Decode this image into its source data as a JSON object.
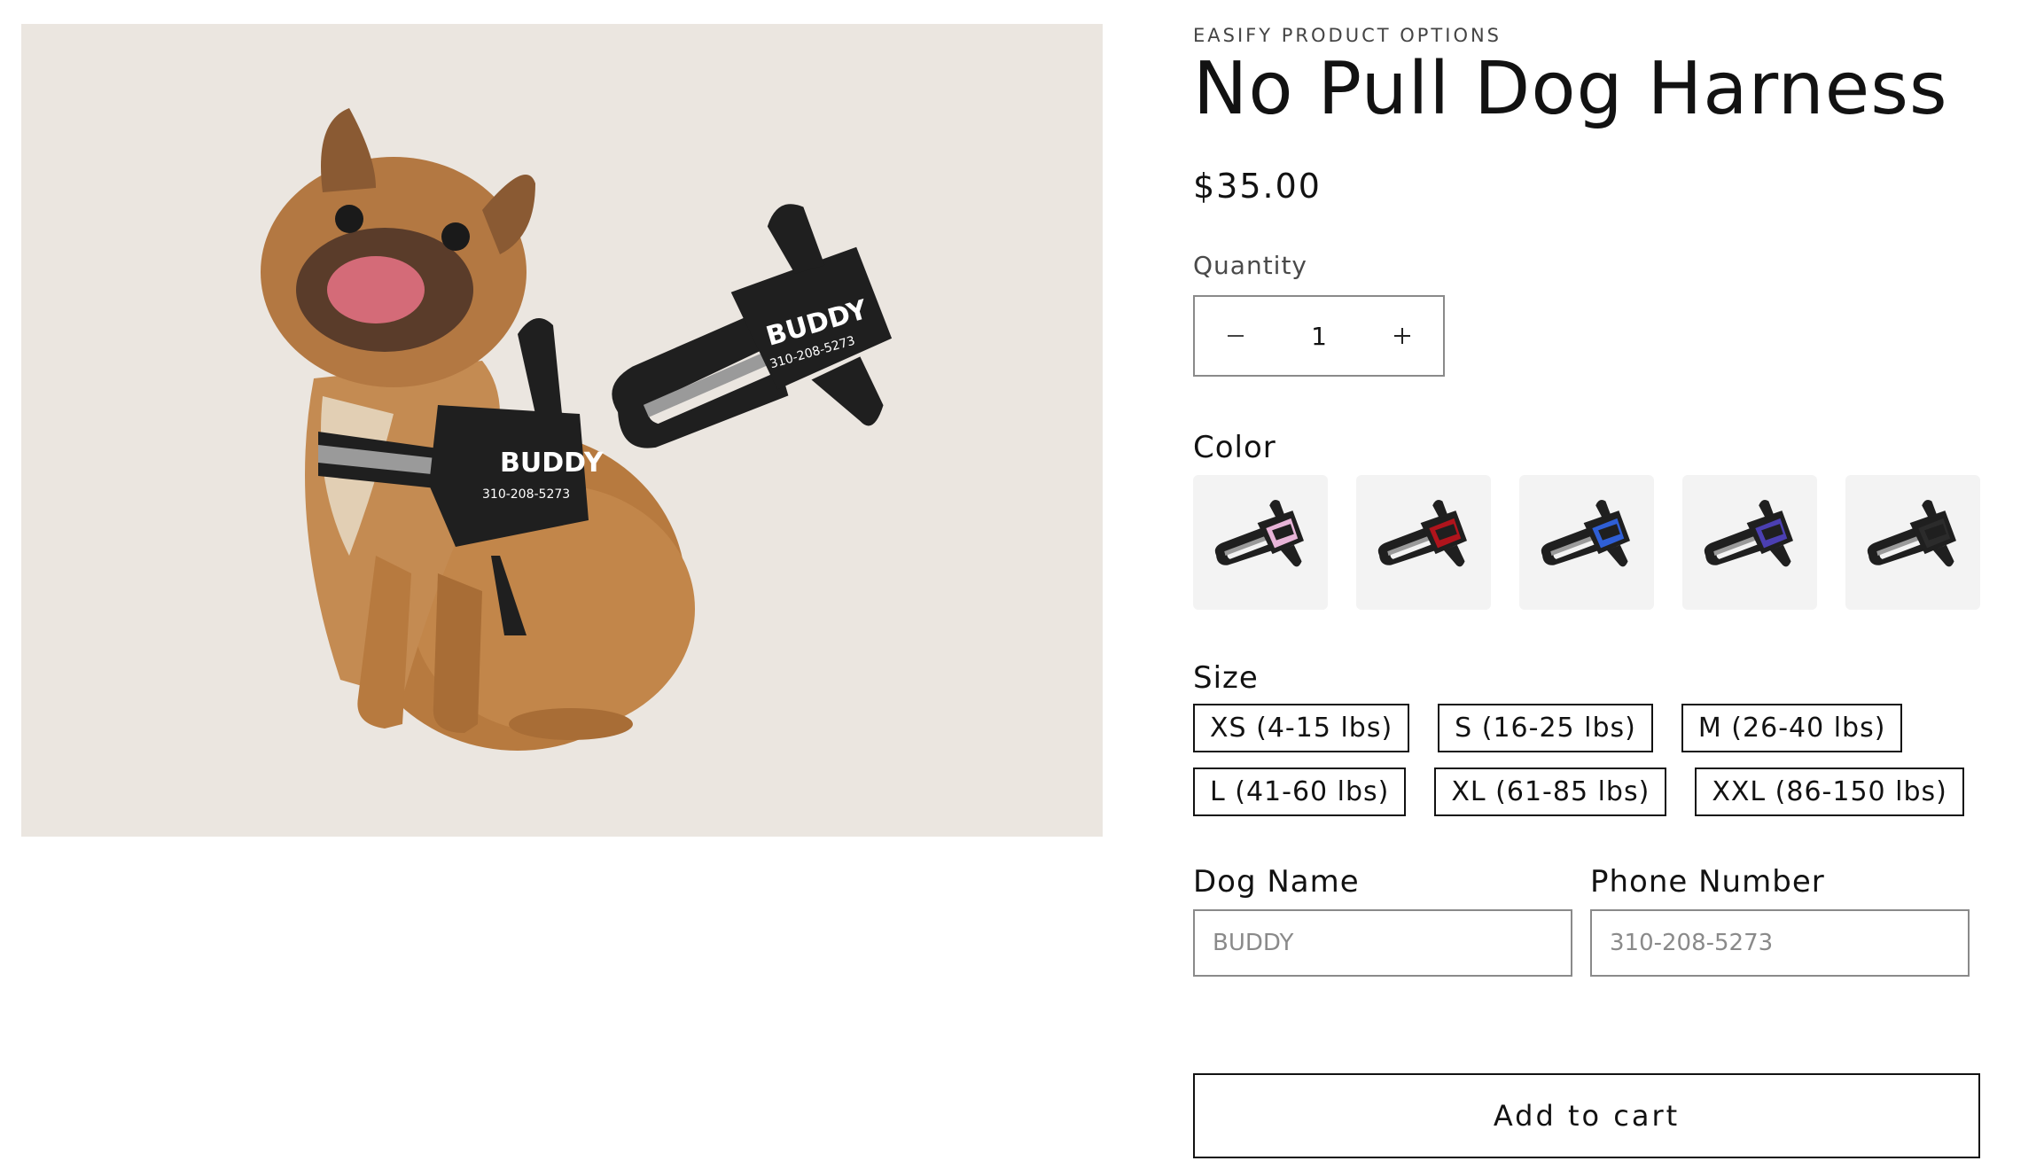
{
  "product": {
    "vendor": "EASIFY PRODUCT OPTIONS",
    "title": "No Pull Dog Harness",
    "price": "$35.00",
    "image_alt": "French bulldog wearing a black harness next to a second harness",
    "image_labels": {
      "name": "BUDDY",
      "phone": "310-208-5273"
    }
  },
  "quantity": {
    "label": "Quantity",
    "value": "1",
    "decrease_icon": "minus-icon",
    "increase_icon": "plus-icon"
  },
  "color": {
    "label": "Color",
    "swatches": [
      {
        "name": "Pink",
        "accent": "#e8b4d8"
      },
      {
        "name": "Red",
        "accent": "#b0141c"
      },
      {
        "name": "Blue",
        "accent": "#2f5fd6"
      },
      {
        "name": "Purple",
        "accent": "#4b3fb2"
      },
      {
        "name": "Black",
        "accent": "#2b2b2b"
      }
    ]
  },
  "size": {
    "label": "Size",
    "options": [
      "XS (4-15 lbs)",
      "S (16-25 lbs)",
      "M (26-40 lbs)",
      "L (41-60 lbs)",
      "XL (61-85 lbs)",
      "XXL (86-150 lbs)"
    ]
  },
  "dog_name": {
    "label": "Dog Name",
    "placeholder": "BUDDY"
  },
  "phone_number": {
    "label": "Phone Number",
    "placeholder": "310-208-5273"
  },
  "cart": {
    "label": "Add to cart"
  },
  "colors": {
    "media_bg": "#ebe6e0",
    "harness": "#1f1f1f",
    "reflective": "#9a9a9a",
    "dog": "#b77a3f",
    "text": "#121212"
  }
}
